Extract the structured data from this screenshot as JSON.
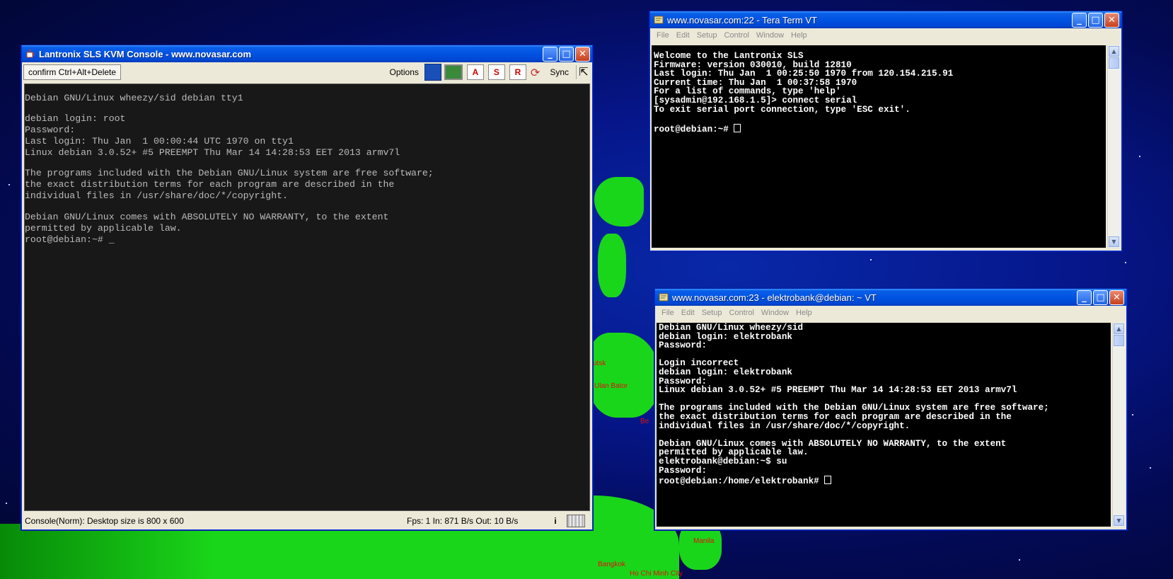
{
  "background": {
    "cities": [
      "Ulan Bator",
      "Bangkok",
      "Ho Chi Minh City",
      "Manila",
      "utsk",
      "Be"
    ],
    "colors": {
      "ocean": "#06168a",
      "land": "#1ad61a",
      "city": "#e01010"
    }
  },
  "kvm": {
    "title": "Lantronix SLS KVM Console - www.novasar.com",
    "toolbar": {
      "cad_button": "confirm Ctrl+Alt+Delete",
      "options_label": "Options",
      "tool_icons": [
        "save-icon",
        "monitor-icon",
        "a-icon",
        "s-icon",
        "r-icon"
      ],
      "sync_label": "Sync"
    },
    "console_lines": [
      "Debian GNU/Linux wheezy/sid debian tty1",
      "",
      "debian login: root",
      "Password:",
      "Last login: Thu Jan  1 00:00:44 UTC 1970 on tty1",
      "Linux debian 3.0.52+ #5 PREEMPT Thu Mar 14 14:28:53 EET 2013 armv7l",
      "",
      "The programs included with the Debian GNU/Linux system are free software;",
      "the exact distribution terms for each program are described in the",
      "individual files in /usr/share/doc/*/copyright.",
      "",
      "Debian GNU/Linux comes with ABSOLUTELY NO WARRANTY, to the extent",
      "permitted by applicable law.",
      "root@debian:~# _"
    ],
    "status_left": "Console(Norm): Desktop size is 800 x 600",
    "status_right": "Fps: 1 In: 871 B/s Out: 10 B/s"
  },
  "teraterm1": {
    "title": "www.novasar.com:22 - Tera Term VT",
    "menu": [
      "File",
      "Edit",
      "Setup",
      "Control",
      "Window",
      "Help"
    ],
    "lines": [
      "Welcome to the Lantronix SLS",
      "Firmware: version 030010, build 12810",
      "Last login: Thu Jan  1 00:25:50 1970 from 120.154.215.91",
      "Current time: Thu Jan  1 00:37:58 1970",
      "For a list of commands, type 'help'",
      "[sysadmin@192.168.1.5]> connect serial",
      "To exit serial port connection, type 'ESC exit'.",
      ""
    ],
    "prompt": "root@debian:~# "
  },
  "teraterm2": {
    "title": "www.novasar.com:23 - elektrobank@debian: ~ VT",
    "menu": [
      "File",
      "Edit",
      "Setup",
      "Control",
      "Window",
      "Help"
    ],
    "lines": [
      "Debian GNU/Linux wheezy/sid",
      "debian login: elektrobank",
      "Password:",
      "",
      "Login incorrect",
      "debian login: elektrobank",
      "Password:",
      "Linux debian 3.0.52+ #5 PREEMPT Thu Mar 14 14:28:53 EET 2013 armv7l",
      "",
      "The programs included with the Debian GNU/Linux system are free software;",
      "the exact distribution terms for each program are described in the",
      "individual files in /usr/share/doc/*/copyright.",
      "",
      "Debian GNU/Linux comes with ABSOLUTELY NO WARRANTY, to the extent",
      "permitted by applicable law.",
      "elektrobank@debian:~$ su",
      "Password:"
    ],
    "prompt": "root@debian:/home/elektrobank# "
  }
}
